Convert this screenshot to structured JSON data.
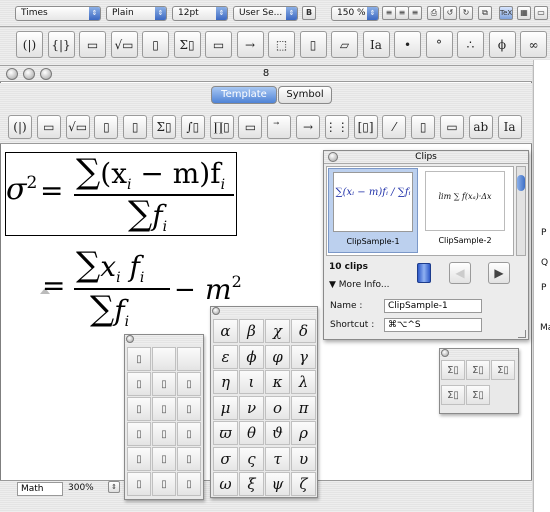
{
  "format_bar": {
    "font_name": "Times",
    "style": "Plain",
    "size": "12pt",
    "size_set": "User Se...",
    "zoom": "150 %"
  },
  "palette_symbols": [
    "(|)",
    "{|}",
    "▭",
    "√▭",
    "▯",
    "Σ▯",
    "▭",
    "→",
    "⬚",
    "▯",
    "▱",
    "Ia",
    "•",
    "°",
    "∴",
    "ϕ",
    "∞"
  ],
  "doc_window": {
    "title": "8",
    "tabs": [
      "Template",
      "Symbol"
    ],
    "template_symbols": [
      "(|)",
      "▭",
      "√▭",
      "▯",
      "▯",
      "Σ▯",
      "∫▯",
      "∏▯",
      "▭",
      "⃗",
      "→",
      "⋮⋮",
      "[▯]",
      "⁄",
      "▯",
      "▭",
      "ab",
      "Ia"
    ],
    "statusbar": {
      "style": "Math",
      "zoom": "300%"
    }
  },
  "equation1": {
    "lhs": "σ",
    "exp": "2",
    "num_sum": "∑",
    "num_body": "(x",
    "num_i": "i",
    "num_rest": " − m)f",
    "num_i2": "i",
    "den_sum": "∑",
    "den_f": "f",
    "den_i": "i"
  },
  "equation2": {
    "num_sum": "∑",
    "num_x": "x",
    "num_i": "i",
    "num_f": "f",
    "num_i2": "i",
    "den_sum": "∑",
    "den_f": "f",
    "den_i": "i",
    "minus": "−",
    "m": "m",
    "exp": "2"
  },
  "clips": {
    "title": "Clips",
    "items": [
      {
        "label": "ClipSample-1",
        "expr": "∑(xᵢ − m)fᵢ / ∑fᵢ"
      },
      {
        "label": "ClipSample-2",
        "expr": "lim ∑ f(xₐ)·Δx"
      }
    ],
    "count": "10 clips",
    "more_info": "More Info...",
    "name_label": "Name :",
    "name_value": "ClipSample-1",
    "shortcut_label": "Shortcut :",
    "shortcut_value": "⌘⌥^S"
  },
  "greek_palette": [
    "α",
    "β",
    "χ",
    "δ",
    "ε",
    "ϕ",
    "φ",
    "γ",
    "η",
    "ι",
    "κ",
    "λ",
    "μ",
    "ν",
    "ο",
    "π",
    "ϖ",
    "θ",
    "ϑ",
    "ρ",
    "σ",
    "ς",
    "τ",
    "υ",
    "ω",
    "ξ",
    "ψ",
    "ζ"
  ],
  "side_letters": [
    "P",
    "Q",
    "P",
    "Ma"
  ]
}
